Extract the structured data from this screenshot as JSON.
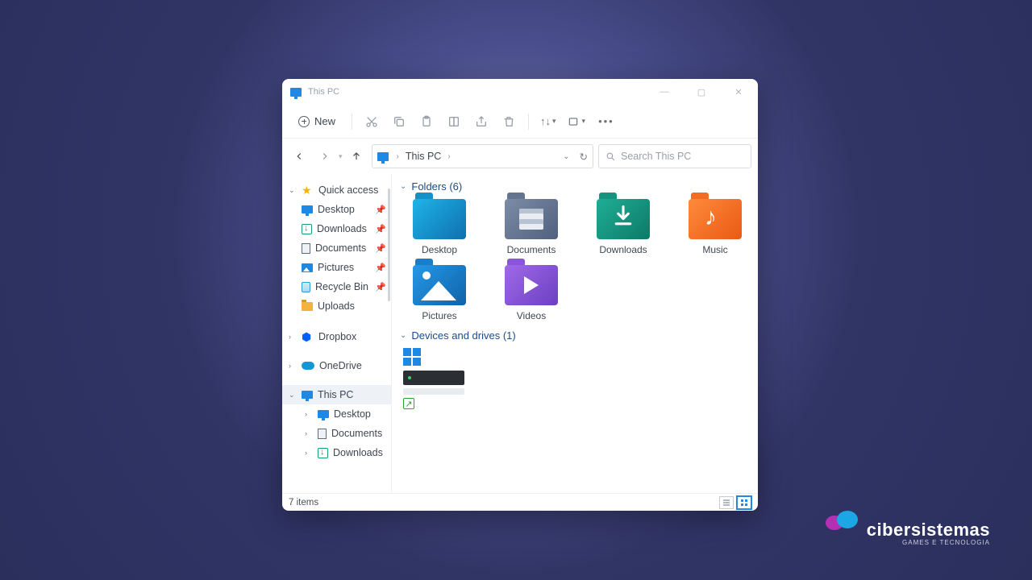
{
  "window": {
    "title": "This PC"
  },
  "toolbar": {
    "new_label": "New"
  },
  "breadcrumb": {
    "location": "This PC"
  },
  "search": {
    "placeholder": "Search This PC"
  },
  "sidebar": {
    "quick_access": {
      "label": "Quick access",
      "items": [
        {
          "label": "Desktop"
        },
        {
          "label": "Downloads"
        },
        {
          "label": "Documents"
        },
        {
          "label": "Pictures"
        },
        {
          "label": "Recycle Bin"
        },
        {
          "label": "Uploads"
        }
      ]
    },
    "dropbox": {
      "label": "Dropbox"
    },
    "onedrive": {
      "label": "OneDrive"
    },
    "this_pc": {
      "label": "This PC",
      "items": [
        {
          "label": "Desktop"
        },
        {
          "label": "Documents"
        },
        {
          "label": "Downloads"
        }
      ]
    }
  },
  "sections": {
    "folders": {
      "title": "Folders (6)",
      "items": [
        {
          "label": "Desktop"
        },
        {
          "label": "Documents"
        },
        {
          "label": "Downloads"
        },
        {
          "label": "Music"
        },
        {
          "label": "Pictures"
        },
        {
          "label": "Videos"
        }
      ]
    },
    "drives": {
      "title": "Devices and drives (1)"
    }
  },
  "status": {
    "items": "7 items"
  },
  "brand": {
    "name": "cibersistemas",
    "tagline": "GAMES E TECNOLOGIA"
  }
}
